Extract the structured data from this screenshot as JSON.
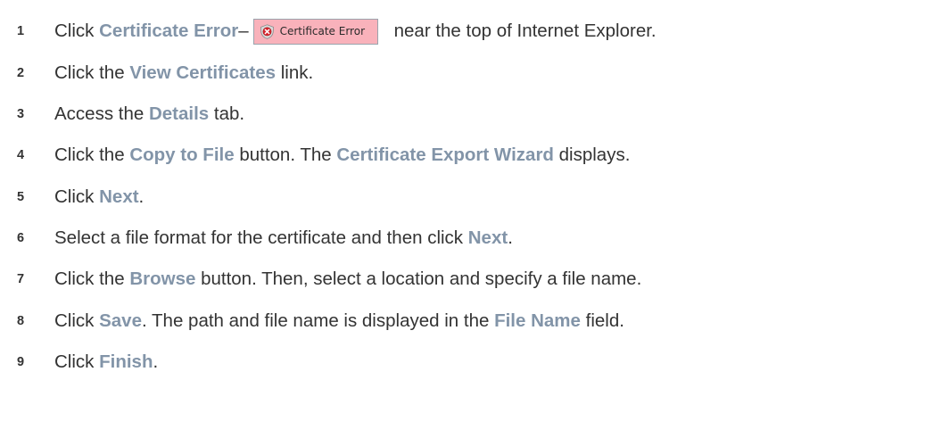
{
  "steps": [
    {
      "num": "1",
      "parts": [
        {
          "text": "Click ",
          "hl": false
        },
        {
          "text": "Certificate Error",
          "hl": true
        },
        {
          "text": "–",
          "hl": false
        },
        {
          "button": true
        },
        {
          "text": "near the top of Internet Explorer.",
          "hl": false
        }
      ]
    },
    {
      "num": "2",
      "parts": [
        {
          "text": "Click the ",
          "hl": false
        },
        {
          "text": "View Certificates",
          "hl": true
        },
        {
          "text": " link.",
          "hl": false
        }
      ]
    },
    {
      "num": "3",
      "parts": [
        {
          "text": "Access the ",
          "hl": false
        },
        {
          "text": "Details",
          "hl": true
        },
        {
          "text": " tab.",
          "hl": false
        }
      ]
    },
    {
      "num": "4",
      "parts": [
        {
          "text": "Click the ",
          "hl": false
        },
        {
          "text": "Copy to File",
          "hl": true
        },
        {
          "text": " button. The ",
          "hl": false
        },
        {
          "text": "Certificate Export Wizard",
          "hl": true
        },
        {
          "text": " displays.",
          "hl": false
        }
      ]
    },
    {
      "num": "5",
      "parts": [
        {
          "text": "Click ",
          "hl": false
        },
        {
          "text": "Next",
          "hl": true
        },
        {
          "text": ".",
          "hl": false
        }
      ]
    },
    {
      "num": "6",
      "parts": [
        {
          "text": "Select a file format for the certificate and then click ",
          "hl": false
        },
        {
          "text": "Next",
          "hl": true
        },
        {
          "text": ".",
          "hl": false
        }
      ]
    },
    {
      "num": "7",
      "parts": [
        {
          "text": "Click the ",
          "hl": false
        },
        {
          "text": "Browse",
          "hl": true
        },
        {
          "text": " button. Then, select a location and specify a file name.",
          "hl": false
        }
      ]
    },
    {
      "num": "8",
      "parts": [
        {
          "text": "Click ",
          "hl": false
        },
        {
          "text": "Save",
          "hl": true
        },
        {
          "text": ". The path and file name is displayed in the ",
          "hl": false
        },
        {
          "text": "File Name",
          "hl": true
        },
        {
          "text": " field.",
          "hl": false
        }
      ]
    },
    {
      "num": "9",
      "parts": [
        {
          "text": "Click ",
          "hl": false
        },
        {
          "text": "Finish",
          "hl": true
        },
        {
          "text": ".",
          "hl": false
        }
      ]
    }
  ],
  "cert_button": {
    "label": "Certificate Error",
    "icon": "shield-error-icon",
    "background": "#f9b2bb"
  },
  "colors": {
    "text": "#333333",
    "highlight": "#8294a8"
  }
}
